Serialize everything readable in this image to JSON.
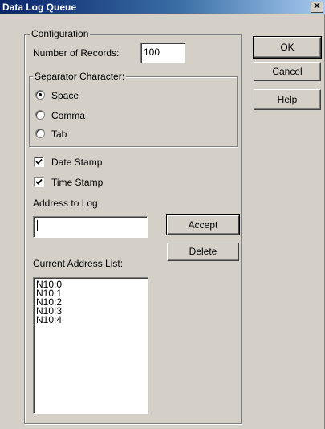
{
  "window": {
    "title": "Data Log Queue",
    "close_glyph": "✕"
  },
  "configuration": {
    "legend": "Configuration",
    "number_of_records_label": "Number of Records:",
    "number_of_records_value": "100",
    "separator": {
      "legend": "Separator Character:",
      "options": [
        {
          "label": "Space",
          "selected": true
        },
        {
          "label": "Comma",
          "selected": false
        },
        {
          "label": "Tab",
          "selected": false
        }
      ]
    },
    "date_stamp": {
      "label": "Date Stamp",
      "checked": true
    },
    "time_stamp": {
      "label": "Time Stamp",
      "checked": true
    },
    "address_to_log_label": "Address to Log",
    "address_to_log_value": "",
    "current_address_list_label": "Current Address List:",
    "addresses": [
      "N10:0",
      "N10:1",
      "N10:2",
      "N10:3",
      "N10:4"
    ]
  },
  "buttons": {
    "ok": "OK",
    "cancel": "Cancel",
    "help": "Help",
    "accept": "Accept",
    "delete": "Delete"
  },
  "icons": {
    "check": "check-icon",
    "radio_dot": "radio-dot-icon"
  }
}
